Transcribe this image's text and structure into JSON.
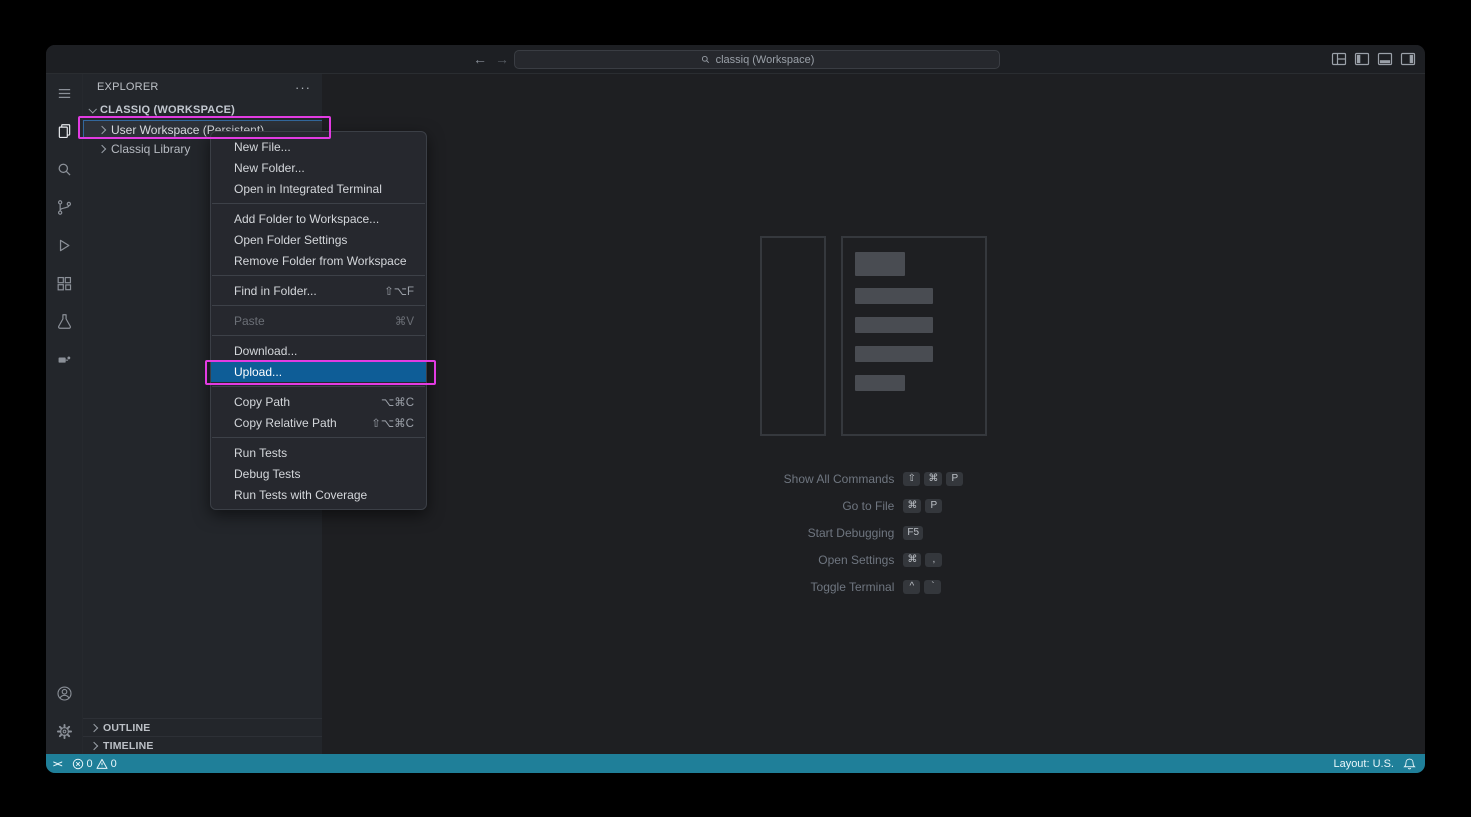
{
  "titlebar": {
    "back_icon": "←",
    "forward_icon": "→",
    "command_center": "classiq (Workspace)"
  },
  "sidebar": {
    "header": {
      "title": "EXPLORER",
      "more_icon": "···"
    },
    "workspace": {
      "label": "CLASSIQ (WORKSPACE)"
    },
    "tree": [
      {
        "label": "User Workspace (Persistent)"
      },
      {
        "label": "Classiq Library"
      }
    ],
    "panels": [
      {
        "label": "OUTLINE"
      },
      {
        "label": "TIMELINE"
      }
    ]
  },
  "context_menu": {
    "items": [
      {
        "label": "New File..."
      },
      {
        "label": "New Folder..."
      },
      {
        "label": "Open in Integrated Terminal"
      },
      {
        "label": "Add Folder to Workspace..."
      },
      {
        "label": "Open Folder Settings"
      },
      {
        "label": "Remove Folder from Workspace"
      },
      {
        "label": "Find in Folder...",
        "shortcut": "⇧⌥F"
      },
      {
        "label": "Paste",
        "shortcut": "⌘V",
        "disabled": true
      },
      {
        "label": "Download..."
      },
      {
        "label": "Upload...",
        "selected": true
      },
      {
        "label": "Copy Path",
        "shortcut": "⌥⌘C"
      },
      {
        "label": "Copy Relative Path",
        "shortcut": "⇧⌥⌘C"
      },
      {
        "label": "Run Tests"
      },
      {
        "label": "Debug Tests"
      },
      {
        "label": "Run Tests with Coverage"
      }
    ]
  },
  "editor": {
    "shortcuts": [
      {
        "label": "Show All Commands",
        "keys": [
          "⇧",
          "⌘",
          "P"
        ]
      },
      {
        "label": "Go to File",
        "keys": [
          "⌘",
          "P"
        ]
      },
      {
        "label": "Start Debugging",
        "keys": [
          "F5"
        ]
      },
      {
        "label": "Open Settings",
        "keys": [
          "⌘",
          ","
        ]
      },
      {
        "label": "Toggle Terminal",
        "keys": [
          "^",
          "`"
        ]
      }
    ]
  },
  "status_bar": {
    "remote_icon": "><",
    "errors": "0",
    "warnings": "0",
    "layout_label": "Layout: U.S."
  },
  "colors": {
    "status_bar": "#1f7f99",
    "menu_selection": "#0e5d97",
    "annotation": "#e23be2",
    "sidebar_bg": "#23262b",
    "editor_bg": "#1e1f22"
  }
}
